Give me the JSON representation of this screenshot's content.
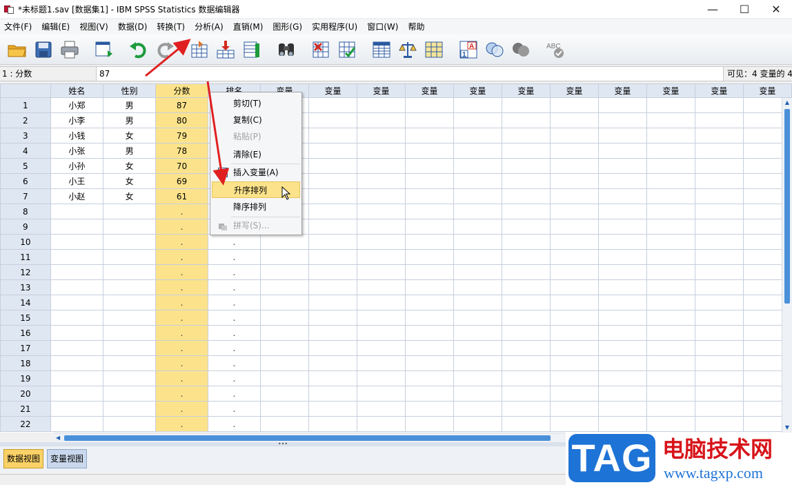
{
  "window": {
    "title": "*未标题1.sav [数据集1] - IBM SPSS Statistics 数据编辑器",
    "minimize_glyph": "—",
    "maximize_glyph": "☐",
    "close_glyph": "✕"
  },
  "menubar": {
    "items": [
      "文件(F)",
      "编辑(E)",
      "视图(V)",
      "数据(D)",
      "转换(T)",
      "分析(A)",
      "直销(M)",
      "图形(G)",
      "实用程序(U)",
      "窗口(W)",
      "帮助"
    ]
  },
  "toolbar": {
    "icons": [
      "open-folder-icon",
      "save-icon",
      "print-icon",
      "recall-dialog-icon",
      "undo-icon",
      "redo-icon",
      "goto-case-icon",
      "goto-variable-icon",
      "variables-icon",
      "find-icon",
      "insert-cases-icon",
      "insert-variable-icon",
      "split-file-icon",
      "weight-cases-icon",
      "select-cases-icon",
      "value-labels-icon",
      "use-sets-icon",
      "show-all-variables-icon",
      "spell-check-icon"
    ]
  },
  "cell_info": {
    "reference": "1 : 分数",
    "value": "87",
    "visible": "可见：4 变量的 4"
  },
  "grid": {
    "columns": [
      "姓名",
      "性别",
      "分数",
      "排名",
      "变量",
      "变量",
      "变量",
      "变量",
      "变量",
      "变量",
      "变量",
      "变量",
      "变量",
      "变量",
      "变量"
    ],
    "selected_column": 2,
    "rows": [
      {
        "num": "1",
        "cells": [
          "小郑",
          "男",
          "87",
          "",
          "",
          "",
          "",
          "",
          "",
          "",
          "",
          "",
          "",
          "",
          ""
        ]
      },
      {
        "num": "2",
        "cells": [
          "小李",
          "男",
          "80",
          "",
          "",
          "",
          "",
          "",
          "",
          "",
          "",
          "",
          "",
          "",
          ""
        ]
      },
      {
        "num": "3",
        "cells": [
          "小钱",
          "女",
          "79",
          "",
          "",
          "",
          "",
          "",
          "",
          "",
          "",
          "",
          "",
          "",
          ""
        ]
      },
      {
        "num": "4",
        "cells": [
          "小张",
          "男",
          "78",
          "",
          "",
          "",
          "",
          "",
          "",
          "",
          "",
          "",
          "",
          "",
          ""
        ]
      },
      {
        "num": "5",
        "cells": [
          "小孙",
          "女",
          "70",
          "",
          "",
          "",
          "",
          "",
          "",
          "",
          "",
          "",
          "",
          "",
          ""
        ]
      },
      {
        "num": "6",
        "cells": [
          "小王",
          "女",
          "69",
          "",
          "",
          "",
          "",
          "",
          "",
          "",
          "",
          "",
          "",
          "",
          ""
        ]
      },
      {
        "num": "7",
        "cells": [
          "小赵",
          "女",
          "61",
          "",
          "",
          "",
          "",
          "",
          "",
          "",
          "",
          "",
          "",
          "",
          ""
        ]
      },
      {
        "num": "8",
        "cells": [
          "",
          "",
          ".",
          ".",
          "",
          "",
          "",
          "",
          "",
          "",
          "",
          "",
          "",
          "",
          ""
        ]
      },
      {
        "num": "9",
        "cells": [
          "",
          "",
          ".",
          ".",
          "",
          "",
          "",
          "",
          "",
          "",
          "",
          "",
          "",
          "",
          ""
        ]
      },
      {
        "num": "10",
        "cells": [
          "",
          "",
          ".",
          ".",
          "",
          "",
          "",
          "",
          "",
          "",
          "",
          "",
          "",
          "",
          ""
        ]
      },
      {
        "num": "11",
        "cells": [
          "",
          "",
          ".",
          ".",
          "",
          "",
          "",
          "",
          "",
          "",
          "",
          "",
          "",
          "",
          ""
        ]
      },
      {
        "num": "12",
        "cells": [
          "",
          "",
          ".",
          ".",
          "",
          "",
          "",
          "",
          "",
          "",
          "",
          "",
          "",
          "",
          ""
        ]
      },
      {
        "num": "13",
        "cells": [
          "",
          "",
          ".",
          ".",
          "",
          "",
          "",
          "",
          "",
          "",
          "",
          "",
          "",
          "",
          ""
        ]
      },
      {
        "num": "14",
        "cells": [
          "",
          "",
          ".",
          ".",
          "",
          "",
          "",
          "",
          "",
          "",
          "",
          "",
          "",
          "",
          ""
        ]
      },
      {
        "num": "15",
        "cells": [
          "",
          "",
          ".",
          ".",
          "",
          "",
          "",
          "",
          "",
          "",
          "",
          "",
          "",
          "",
          ""
        ]
      },
      {
        "num": "16",
        "cells": [
          "",
          "",
          ".",
          ".",
          "",
          "",
          "",
          "",
          "",
          "",
          "",
          "",
          "",
          "",
          ""
        ]
      },
      {
        "num": "17",
        "cells": [
          "",
          "",
          ".",
          ".",
          "",
          "",
          "",
          "",
          "",
          "",
          "",
          "",
          "",
          "",
          ""
        ]
      },
      {
        "num": "18",
        "cells": [
          "",
          "",
          ".",
          ".",
          "",
          "",
          "",
          "",
          "",
          "",
          "",
          "",
          "",
          "",
          ""
        ]
      },
      {
        "num": "19",
        "cells": [
          "",
          "",
          ".",
          ".",
          "",
          "",
          "",
          "",
          "",
          "",
          "",
          "",
          "",
          "",
          ""
        ]
      },
      {
        "num": "20",
        "cells": [
          "",
          "",
          ".",
          ".",
          "",
          "",
          "",
          "",
          "",
          "",
          "",
          "",
          "",
          "",
          ""
        ]
      },
      {
        "num": "21",
        "cells": [
          "",
          "",
          ".",
          ".",
          "",
          "",
          "",
          "",
          "",
          "",
          "",
          "",
          "",
          "",
          ""
        ]
      },
      {
        "num": "22",
        "cells": [
          "",
          "",
          ".",
          ".",
          "",
          "",
          "",
          "",
          "",
          "",
          "",
          "",
          "",
          "",
          ""
        ]
      }
    ]
  },
  "context_menu": {
    "items": [
      {
        "label": "剪切(T)",
        "enabled": true
      },
      {
        "label": "复制(C)",
        "enabled": true
      },
      {
        "label": "粘贴(P)",
        "enabled": false
      },
      {
        "label": "清除(E)",
        "enabled": true
      },
      {
        "label": "插入变量(A)",
        "enabled": true
      },
      {
        "label": "升序排列",
        "enabled": true,
        "highlighted": true
      },
      {
        "label": "降序排列",
        "enabled": true
      },
      {
        "label": "拼写(S)...",
        "enabled": false
      }
    ]
  },
  "tabs": {
    "data_view": "数据视图",
    "variable_view": "变量视图"
  },
  "watermark": {
    "logo": "TAG",
    "name": "电脑技术网",
    "url": "www.tagxp.com"
  },
  "colors": {
    "selected_column": "#fce38b",
    "header": "#dfe7f2",
    "annotation_arrow": "#e02020",
    "brand_blue": "#1e73d6",
    "brand_red": "#d7141a"
  }
}
